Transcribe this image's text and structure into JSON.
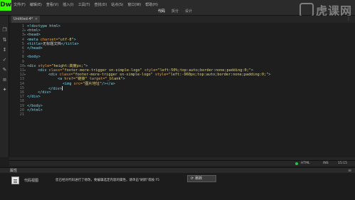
{
  "app": {
    "logo": "Dw"
  },
  "menu": [
    "文件(F)",
    "编辑(E)",
    "查看(V)",
    "插入(I)",
    "工具(T)",
    "查找(D)",
    "站点(S)",
    "窗口(W)",
    "帮助(H)"
  ],
  "workspace_tabs": [
    "代码",
    "拆分",
    "设计"
  ],
  "window_controls": [
    "−",
    "□",
    "✕"
  ],
  "watermark": {
    "text": "虎课网"
  },
  "document": {
    "tab_label": "Untitled-4*",
    "close": "×",
    "filter_icon": "⋮"
  },
  "toolbar_icons": [
    "❐",
    "⇅",
    "↕",
    "✓",
    "✎",
    "≡",
    "✦"
  ],
  "code": {
    "line_numbers": [
      "1",
      "2",
      "3",
      "4",
      "5",
      "6",
      "7",
      "8",
      "9",
      "10",
      "11",
      "12",
      "13",
      "14",
      "15",
      "16",
      "17",
      "18",
      "19",
      "20",
      "21"
    ],
    "fold_markers": [
      "▾",
      "▾",
      "▾",
      "▾",
      "▾"
    ],
    "tokens": {
      "l1": "<!doctype html>",
      "l2": "<html>",
      "l3": "<head>",
      "l4_tag_open": "<meta",
      "l4_attr": "charset=",
      "l4_val": "\"utf-8\"",
      "l4_close": ">",
      "l5_open": "<title>",
      "l5_text": "无标题文档",
      "l5_close": "</title>",
      "l6": "</head>",
      "l8": "<body>",
      "l10_open": "<div",
      "l10_attr": "style=",
      "l10_val": "\"height:高度px;\"",
      "l10_close": ">",
      "l11_open": "<div",
      "l11_attr1": "class=",
      "l11_val1": "\"footer-more-trigger sn-simple-logo\"",
      "l11_attr2": "style=",
      "l11_val2": "\"left:50%;top:auto;border:none;padding:0;\"",
      "l11_close": ">",
      "l12_open": "<div",
      "l12_attr1": "class=",
      "l12_val1": "\"footer-more-trigger sn-simple-logo\"",
      "l12_attr2": "style=",
      "l12_val2": "\"left:-960px;top:auto;border:none;padding:0;\"",
      "l12_close": ">",
      "l13_open": "<a",
      "l13_attr1": "href=",
      "l13_val1": "\"链接\"",
      "l13_attr2": "target=",
      "l13_val2": "\"_blank\"",
      "l13_close": ">",
      "l14_open": "<img",
      "l14_attr": "src=",
      "l14_val": "\"图片地址\"",
      "l14_close": "/></a>",
      "l15": "</div>",
      "l16": "</div>",
      "l17": "</div>",
      "l19": "</body>",
      "l20": "</html>"
    }
  },
  "status_bar": {
    "language": "HTML",
    "ins": "INS",
    "position": "15:15"
  },
  "properties": {
    "title": "属性",
    "menu_icon": "≡",
    "code_view_label": "代码视图",
    "notice": "您已经对代码进行了修改，要编辑选定内容的属性，请单击\"刷新\"或按 F5",
    "refresh_icon": "⟳",
    "refresh_label": "刷新"
  }
}
